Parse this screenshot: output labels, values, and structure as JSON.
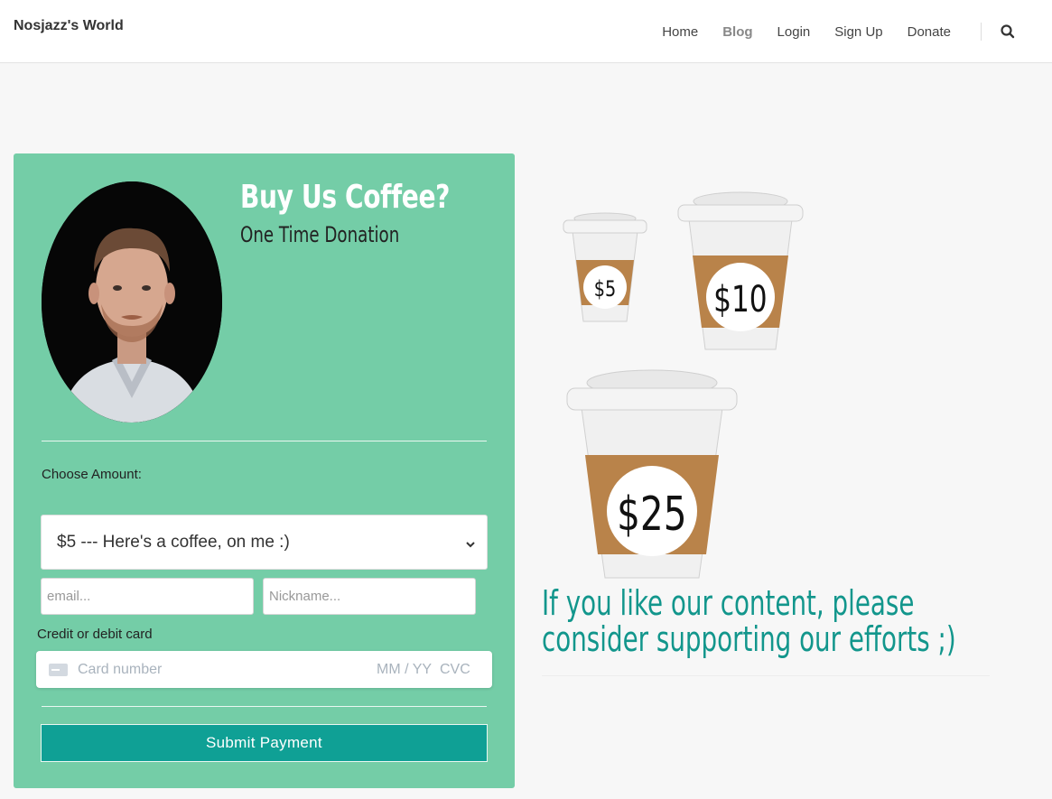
{
  "header": {
    "brand": "Nosjazz's World",
    "nav": [
      {
        "label": "Home"
      },
      {
        "label": "Blog",
        "active": true
      },
      {
        "label": "Login"
      },
      {
        "label": "Sign Up"
      },
      {
        "label": "Donate"
      }
    ],
    "search_icon": "search-icon"
  },
  "donation_card": {
    "title": "Buy Us Coffee?",
    "subtitle": "One Time Donation",
    "choose_amount_label": "Choose Amount:",
    "amount_select": {
      "selected": "$5 --- Here's a coffee, on me :)"
    },
    "email_placeholder": "email...",
    "nickname_placeholder": "Nickname...",
    "card_label": "Credit or debit card",
    "card_number_placeholder": "Card number",
    "expiry_placeholder": "MM / YY",
    "cvc_placeholder": "CVC",
    "submit_label": "Submit Payment"
  },
  "cups": [
    {
      "label": "$5"
    },
    {
      "label": "$10"
    },
    {
      "label": "$25"
    }
  ],
  "pitch": {
    "line1": "If you like our content, please",
    "line2": "consider supporting our efforts ;)"
  },
  "colors": {
    "card_bg": "#74cda7",
    "submit_bg": "#0fa095",
    "pitch_text": "#12968c",
    "cup_sleeve": "#b9834a"
  }
}
